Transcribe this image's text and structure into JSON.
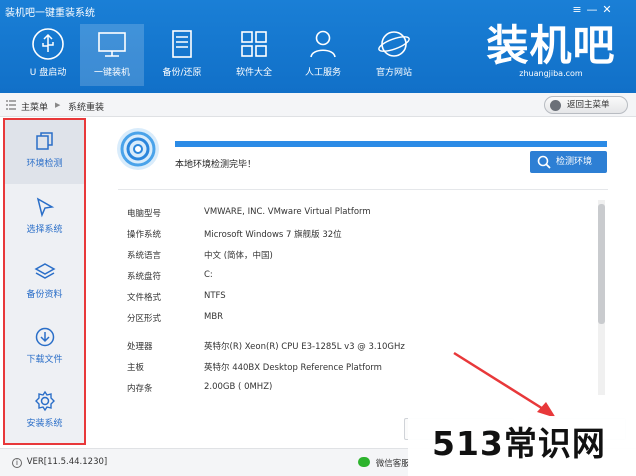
{
  "window": {
    "title": "装机吧一键重装系统",
    "controls": [
      "≡",
      "—",
      "✕"
    ]
  },
  "nav": [
    {
      "label": "U 盘启动",
      "icon": "usb-icon"
    },
    {
      "label": "一键装机",
      "icon": "monitor-icon",
      "active": true
    },
    {
      "label": "备份/还原",
      "icon": "backup-icon"
    },
    {
      "label": "软件大全",
      "icon": "apps-grid-icon"
    },
    {
      "label": "人工服务",
      "icon": "person-icon"
    },
    {
      "label": "官方网站",
      "icon": "globe-icon"
    }
  ],
  "logo": {
    "text": "装机吧",
    "url": "zhuangjiba.com"
  },
  "breadcrumb": {
    "home": "主菜单",
    "separator": "▶",
    "current": "系统重装"
  },
  "back_button": "返回主菜单",
  "sidebar": [
    {
      "label": "环境检测",
      "icon": "copy-icon",
      "active": true
    },
    {
      "label": "选择系统",
      "icon": "cursor-icon"
    },
    {
      "label": "备份资料",
      "icon": "layers-icon"
    },
    {
      "label": "下载文件",
      "icon": "download-icon"
    },
    {
      "label": "安装系统",
      "icon": "gear-icon"
    }
  ],
  "detection": {
    "status": "本地环境检测完毕！",
    "progress": 1.0,
    "button": "检测环境"
  },
  "info": [
    {
      "label": "电脑型号",
      "value": "VMWARE, INC. VMware Virtual Platform"
    },
    {
      "label": "操作系统",
      "value": "Microsoft Windows 7 旗舰版  32位"
    },
    {
      "label": "系统语言",
      "value": "中文 (简体，中国)"
    },
    {
      "label": "系统盘符",
      "value": "C:"
    },
    {
      "label": "文件格式",
      "value": "NTFS"
    },
    {
      "label": "分区形式",
      "value": "MBR"
    },
    {
      "label": "处理器",
      "value": "英特尔(R) Xeon(R) CPU E3-1285L v3 @ 3.10GHz"
    },
    {
      "label": "主板",
      "value": "英特尔 440BX Desktop Reference Platform"
    },
    {
      "label": "内存条",
      "value": "2.00GB ( 0MHZ)"
    }
  ],
  "footer": {
    "version": "VER[11.5.44.1230]",
    "wechat": "微信客服"
  },
  "watermark": "513常识网",
  "colors": {
    "header": "#1a7fd6",
    "accent": "#2d7fd4",
    "highlight_border": "#e8383a",
    "annotation_arrow": "#e8383a"
  }
}
